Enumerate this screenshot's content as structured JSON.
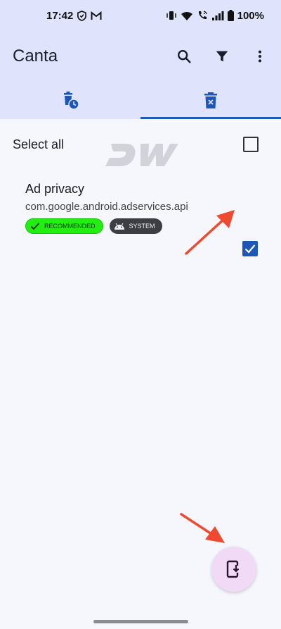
{
  "status_bar": {
    "time": "17:42",
    "battery": "100%",
    "left_icons": [
      "shield-icon",
      "gmail-icon"
    ],
    "right_icons": [
      "vibrate-icon",
      "wifi-icon",
      "wifi-calling-icon",
      "signal-icon",
      "battery-icon"
    ]
  },
  "app_bar": {
    "title": "Canta",
    "actions": [
      "search-icon",
      "filter-icon",
      "more-vert-icon"
    ],
    "background": "#dfe3fb"
  },
  "tabs": [
    {
      "icon": "trash-clock-icon",
      "selected": false
    },
    {
      "icon": "trash-x-icon",
      "selected": true
    }
  ],
  "select_all": {
    "label": "Select all",
    "checked": false
  },
  "watermark": "DW",
  "apps": [
    {
      "name": "Ad privacy",
      "package": "com.google.android.adservices.api",
      "checked": true,
      "badges": [
        {
          "label": "RECOMMENDED",
          "icon": "check-icon",
          "color": "#22ef10"
        },
        {
          "label": "SYSTEM",
          "icon": "android-icon",
          "color": "#3d3e44"
        }
      ]
    }
  ],
  "fab": {
    "icon": "phone-download-icon",
    "color": "#f0daf6"
  },
  "colors": {
    "accent": "#1e56b8",
    "annotation_arrow": "#f0492f"
  }
}
